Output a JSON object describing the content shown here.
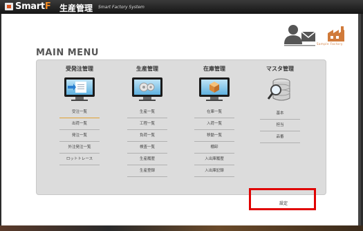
{
  "header": {
    "brand_main": "Smart",
    "brand_accent": "F",
    "app_name": "生産管理",
    "subtitle": "Smart Factory System"
  },
  "top_right": {
    "factory_label": "Sample Factory"
  },
  "main": {
    "title": "MAIN MENU",
    "columns": [
      {
        "title": "受発注管理",
        "icon": "order-screen-icon",
        "items": [
          "受注一覧",
          "出荷一覧",
          "発注一覧",
          "外注発注一覧",
          "ロットトレース"
        ]
      },
      {
        "title": "生産管理",
        "icon": "production-screen-icon",
        "items": [
          "生産一覧",
          "工程一覧",
          "負荷一覧",
          "検査一覧",
          "生産履歴",
          "生産登録"
        ]
      },
      {
        "title": "在庫管理",
        "icon": "inventory-screen-icon",
        "items": [
          "在庫一覧",
          "入荷一覧",
          "移動一覧",
          "棚卸",
          "入出庫履歴",
          "入出庫記録"
        ]
      },
      {
        "title": "マスタ管理",
        "icon": "master-database-icon",
        "items": [
          "基本",
          "担当",
          "品番"
        ]
      }
    ],
    "settings_label": "設定"
  },
  "colors": {
    "highlight": "#e00000",
    "accent": "#f08a24"
  }
}
